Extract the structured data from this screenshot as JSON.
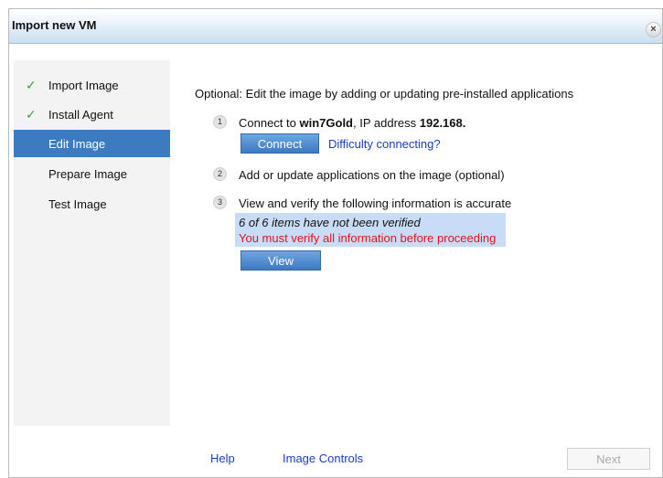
{
  "window": {
    "title": "Import new VM",
    "close_glyph": "×"
  },
  "sidebar": {
    "steps": [
      {
        "label": "Import Image",
        "completed": true
      },
      {
        "label": "Install Agent",
        "completed": true
      },
      {
        "label": "Edit Image",
        "completed": false,
        "active": true
      },
      {
        "label": "Prepare Image",
        "completed": false
      },
      {
        "label": "Test Image",
        "completed": false
      }
    ],
    "check_glyph": "✓"
  },
  "main": {
    "intro": "Optional: Edit the image by adding or updating pre-installed applications",
    "items": [
      {
        "number": "1",
        "text_prefix": "Connect to ",
        "vm_name": "win7Gold",
        "text_middle": ", IP address ",
        "ip_address": "192.168."
      },
      {
        "number": "2",
        "text": "Add or update applications on the image (optional)"
      },
      {
        "number": "3",
        "text": "View and verify the following information is accurate"
      }
    ],
    "connect_button": "Connect",
    "difficulty_link": "Difficulty connecting?",
    "verify_status": "6 of 6 items have not been verified",
    "verify_warning": "You must verify all information before proceeding",
    "view_button": "View"
  },
  "footer": {
    "help_link": "Help",
    "image_controls_link": "Image Controls",
    "next_button": "Next"
  },
  "colors": {
    "accent": "#3c7bbf",
    "check": "#3ea13e",
    "warning": "#e0151b",
    "link": "#1a3fb8",
    "verify_bg": "#c8dcf7"
  }
}
